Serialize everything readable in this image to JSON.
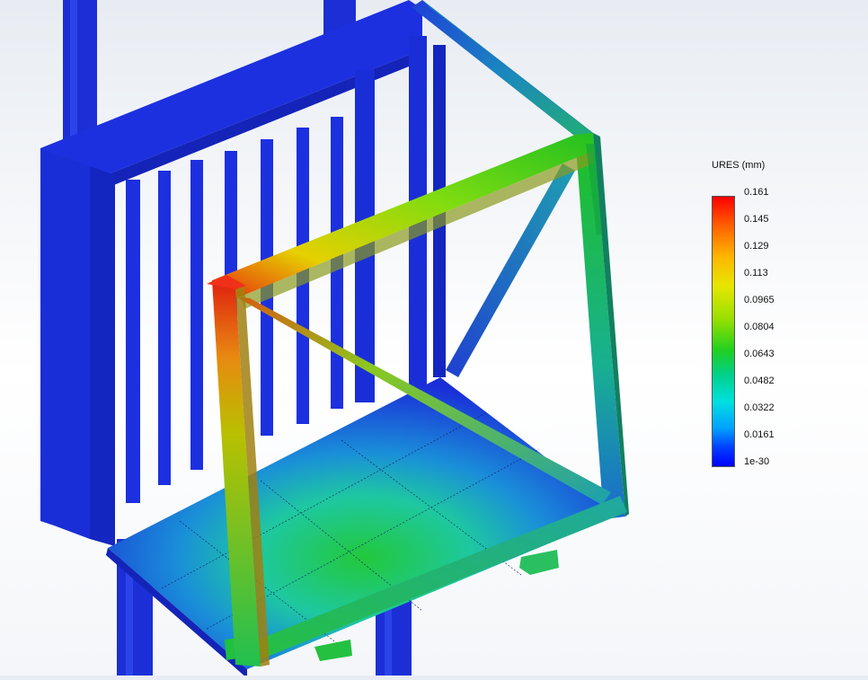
{
  "legend": {
    "title": "URES (mm)",
    "ticks": [
      "0.161",
      "0.145",
      "0.129",
      "0.113",
      "0.0965",
      "0.0804",
      "0.0643",
      "0.0482",
      "0.0322",
      "0.0161",
      "1e-30"
    ]
  },
  "colors": {
    "max": "#ff0000",
    "min": "#0000ff",
    "background": "#ffffff"
  }
}
